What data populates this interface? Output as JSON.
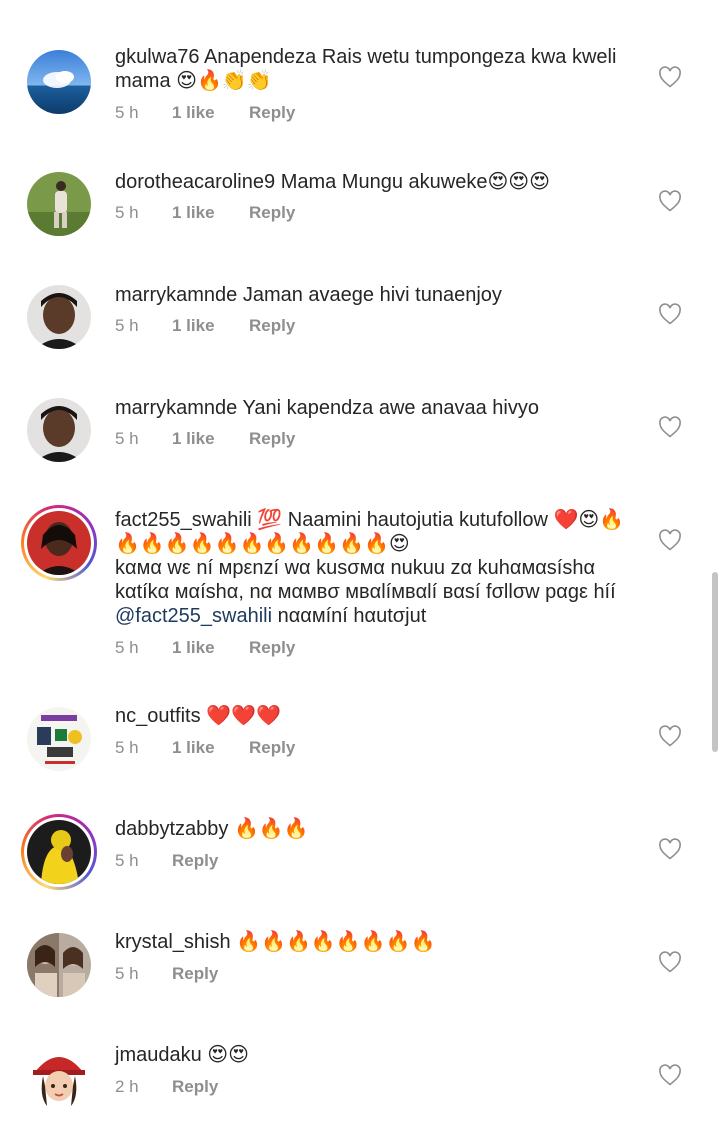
{
  "comments": [
    {
      "username": "gkulwa76",
      "text": "Anapendeza Rais wetu tumpongeza kwa kweli mama 😍🔥👏👏",
      "time": "5 h",
      "likes": "1 like",
      "reply": "Reply"
    },
    {
      "username": "dorotheacaroline9",
      "text": "Mama Mungu akuweke😍😍😍",
      "time": "5 h",
      "likes": "1 like",
      "reply": "Reply"
    },
    {
      "username": "marrykamnde",
      "text": "Jaman avaege hivi tunaenjoy",
      "time": "5 h",
      "likes": "1 like",
      "reply": "Reply"
    },
    {
      "username": "marrykamnde",
      "text": "Yani kapendza awe anavaa hivyo",
      "time": "5 h",
      "likes": "1 like",
      "reply": "Reply"
    },
    {
      "username": "fact255_swahili",
      "text": "💯 Naamini hautojutia kutufollow ❤️😍🔥 🔥🔥🔥🔥🔥🔥🔥🔥🔥🔥🔥😍",
      "text2": "kαмα wε ní мpεnzí wα kusσмα nukuu zα kuhαмαsíshα kαtíkα мαíshα, nα мαмвσ мвαlíмвαlí вαsí fσllσw pαgε híí",
      "mention": "@fact255_swahili",
      "text3": "nααмíní hαutσjut",
      "time": "5 h",
      "likes": "1 like",
      "reply": "Reply"
    },
    {
      "username": "nc_outfits",
      "text": "❤️❤️❤️",
      "time": "5 h",
      "likes": "1 like",
      "reply": "Reply"
    },
    {
      "username": "dabbytzabby",
      "text": "🔥🔥🔥",
      "time": "5 h",
      "reply": "Reply"
    },
    {
      "username": "krystal_shish",
      "text": "🔥🔥🔥🔥🔥🔥🔥🔥",
      "time": "5 h",
      "reply": "Reply"
    },
    {
      "username": "jmaudaku",
      "text": "😍😍",
      "time": "2 h",
      "reply": "Reply"
    }
  ],
  "icons": {
    "like": "heart-outline-icon"
  },
  "colors": {
    "text": "#262626",
    "meta": "#8e8e8e",
    "mention": "#1e3a5f"
  }
}
